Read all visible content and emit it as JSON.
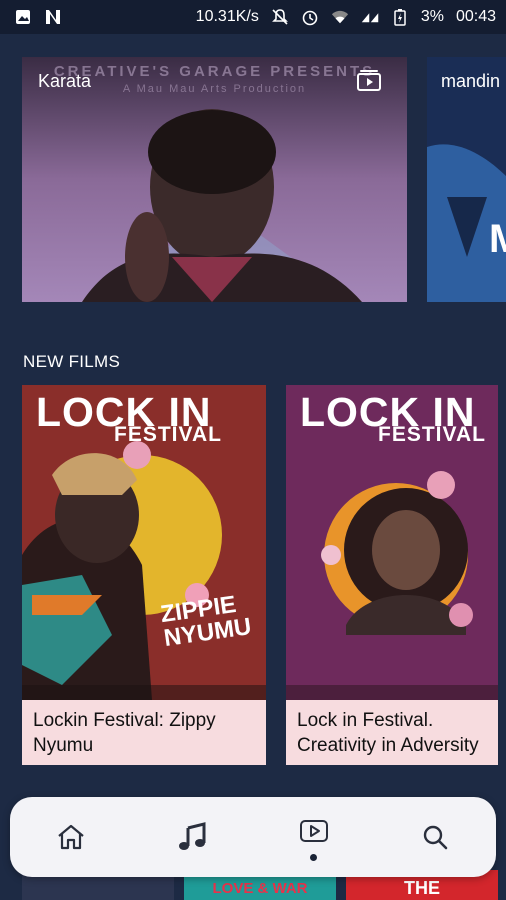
{
  "status_bar": {
    "speed": "10.31K/s",
    "battery": "3%",
    "time": "00:43"
  },
  "featured": [
    {
      "title": "Karata",
      "poster_caption": "CREATIVE'S GARAGE PRESENTS",
      "poster_sub": "A Mau Mau Arts Production"
    },
    {
      "title": "mandin"
    }
  ],
  "sections": {
    "new_films_title": "NEW FILMS"
  },
  "new_films": [
    {
      "poster_title": "LOCK IN",
      "poster_sub": "FESTIVAL",
      "poster_name": "ZIPPIE NYUMU",
      "caption": "Lockin Festival: Zippy Nyumu"
    },
    {
      "poster_title": "LOCK IN",
      "poster_sub": "FESTIVAL",
      "caption": "Lock in Festival. Creativity in Adversity"
    }
  ],
  "bottom_peek": [
    "",
    "LOVE & WAR",
    "THE"
  ],
  "bottom_nav": {
    "items": [
      {
        "icon": "home-icon"
      },
      {
        "icon": "music-icon"
      },
      {
        "icon": "video-icon",
        "active": true
      },
      {
        "icon": "search-icon"
      }
    ]
  },
  "colors": {
    "background": "#1d2a44",
    "caption_bg": "#f7dcdf",
    "nav_bg": "#f3f3f7"
  }
}
